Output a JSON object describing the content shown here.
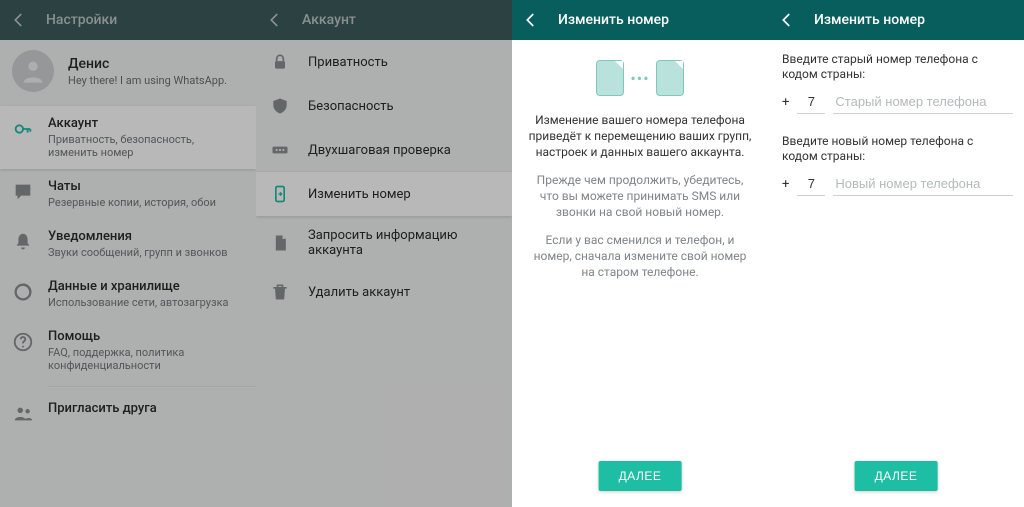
{
  "panel1": {
    "header_title": "Настройки",
    "profile_name": "Денис",
    "profile_status": "Hey there! I am using WhatsApp.",
    "items": [
      {
        "title": "Аккаунт",
        "sub": "Приватность, безопасность, изменить номер"
      },
      {
        "title": "Чаты",
        "sub": "Резервные копии, история, обои"
      },
      {
        "title": "Уведомления",
        "sub": "Звуки сообщений, групп и звонков"
      },
      {
        "title": "Данные и хранилище",
        "sub": "Использование сети, автозагрузка"
      },
      {
        "title": "Помощь",
        "sub": "FAQ, поддержка, политика конфиденциальности"
      },
      {
        "title": "Пригласить друга",
        "sub": ""
      }
    ]
  },
  "panel2": {
    "header_title": "Аккаунт",
    "items": [
      "Приватность",
      "Безопасность",
      "Двухшаговая проверка",
      "Изменить номер",
      "Запросить информацию аккаунта",
      "Удалить аккаунт"
    ]
  },
  "panel3": {
    "header_title": "Изменить номер",
    "para1": "Изменение вашего номера телефона приведёт к перемещению ваших групп, настроек и данных вашего аккаунта.",
    "para2": "Прежде чем продолжить, убедитесь, что вы можете принимать SMS или звонки на свой новый номер.",
    "para3": "Если у вас сменился и телефон, и номер, сначала измените свой номер на старом телефоне.",
    "next": "ДАЛЕЕ"
  },
  "panel4": {
    "header_title": "Изменить номер",
    "old_label": "Введите старый номер телефона с кодом страны:",
    "new_label": "Введите новый номер телефона с кодом страны:",
    "old_cc": "7",
    "new_cc": "7",
    "old_placeholder": "Старый номер телефона",
    "new_placeholder": "Новый номер телефона",
    "next": "ДАЛЕЕ"
  }
}
